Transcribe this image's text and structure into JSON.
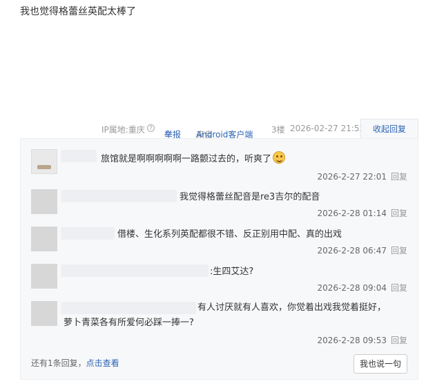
{
  "post": {
    "content": "我也觉得格蕾丝英配太棒了"
  },
  "meta": {
    "ip_location": "IP属地:重庆",
    "help_glyph": "?",
    "report_label": "举报",
    "source_prefix": "来自",
    "source_client": "Android客户端",
    "floor": "3楼",
    "timestamp": "2026-02-27 21:52",
    "collapse_label": "收起回复"
  },
  "replies": [
    {
      "text": "旅馆就是啊啊啊啊啊一路颤过去的，听爽了",
      "has_emoji": true,
      "time": "2026-2-27 22:01",
      "reply_label": "回复"
    },
    {
      "text": "我觉得格蕾丝配音是re3吉尔的配音",
      "time": "2026-2-28 01:14",
      "reply_label": "回复"
    },
    {
      "text": "借楼、生化系列英配都很不错、反正别用中配、真的出戏",
      "time": "2026-2-28 06:47",
      "reply_label": "回复"
    },
    {
      "text": ":生四艾达?",
      "time": "2026-2-28 09:04",
      "reply_label": "回复"
    },
    {
      "text_line1": "有人讨厌就有人喜欢，你觉着出戏我觉着挺好，",
      "text_line2": "萝卜青菜各有所爱何必踩一捧一?",
      "time": "2026-2-28 09:53",
      "reply_label": "回复"
    }
  ],
  "footer": {
    "more_text": "还有1条回复，",
    "view_link": "点击查看",
    "say_button": "我也说一句"
  },
  "colors": {
    "link_blue": "#2d64b3",
    "reply_bg": "#f7f8fa",
    "muted": "#999999"
  }
}
